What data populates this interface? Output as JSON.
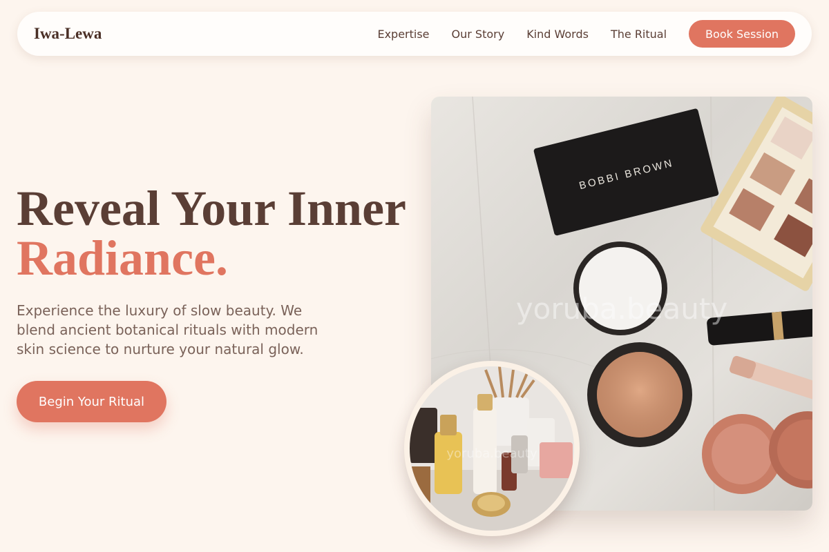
{
  "brand": {
    "name": "Iwa-Lewa"
  },
  "nav": {
    "links": [
      "Expertise",
      "Our Story",
      "Kind Words",
      "The Ritual"
    ],
    "cta": "Book Session"
  },
  "hero": {
    "title_line1": "Reveal Your Inner",
    "title_line2": "Radiance.",
    "subtitle": "Experience the luxury of slow beauty. We blend ancient botanical rituals with modern skin science to nurture your natural glow.",
    "cta": "Begin Your Ritual"
  },
  "images": {
    "main_watermark": "yoruba.beauty",
    "compact_brand": "BOBBI BROWN",
    "round_watermark": "yoruba.beauty"
  },
  "colors": {
    "background": "#fdf5ee",
    "accent": "#e07560",
    "text": "#5a3e35"
  }
}
